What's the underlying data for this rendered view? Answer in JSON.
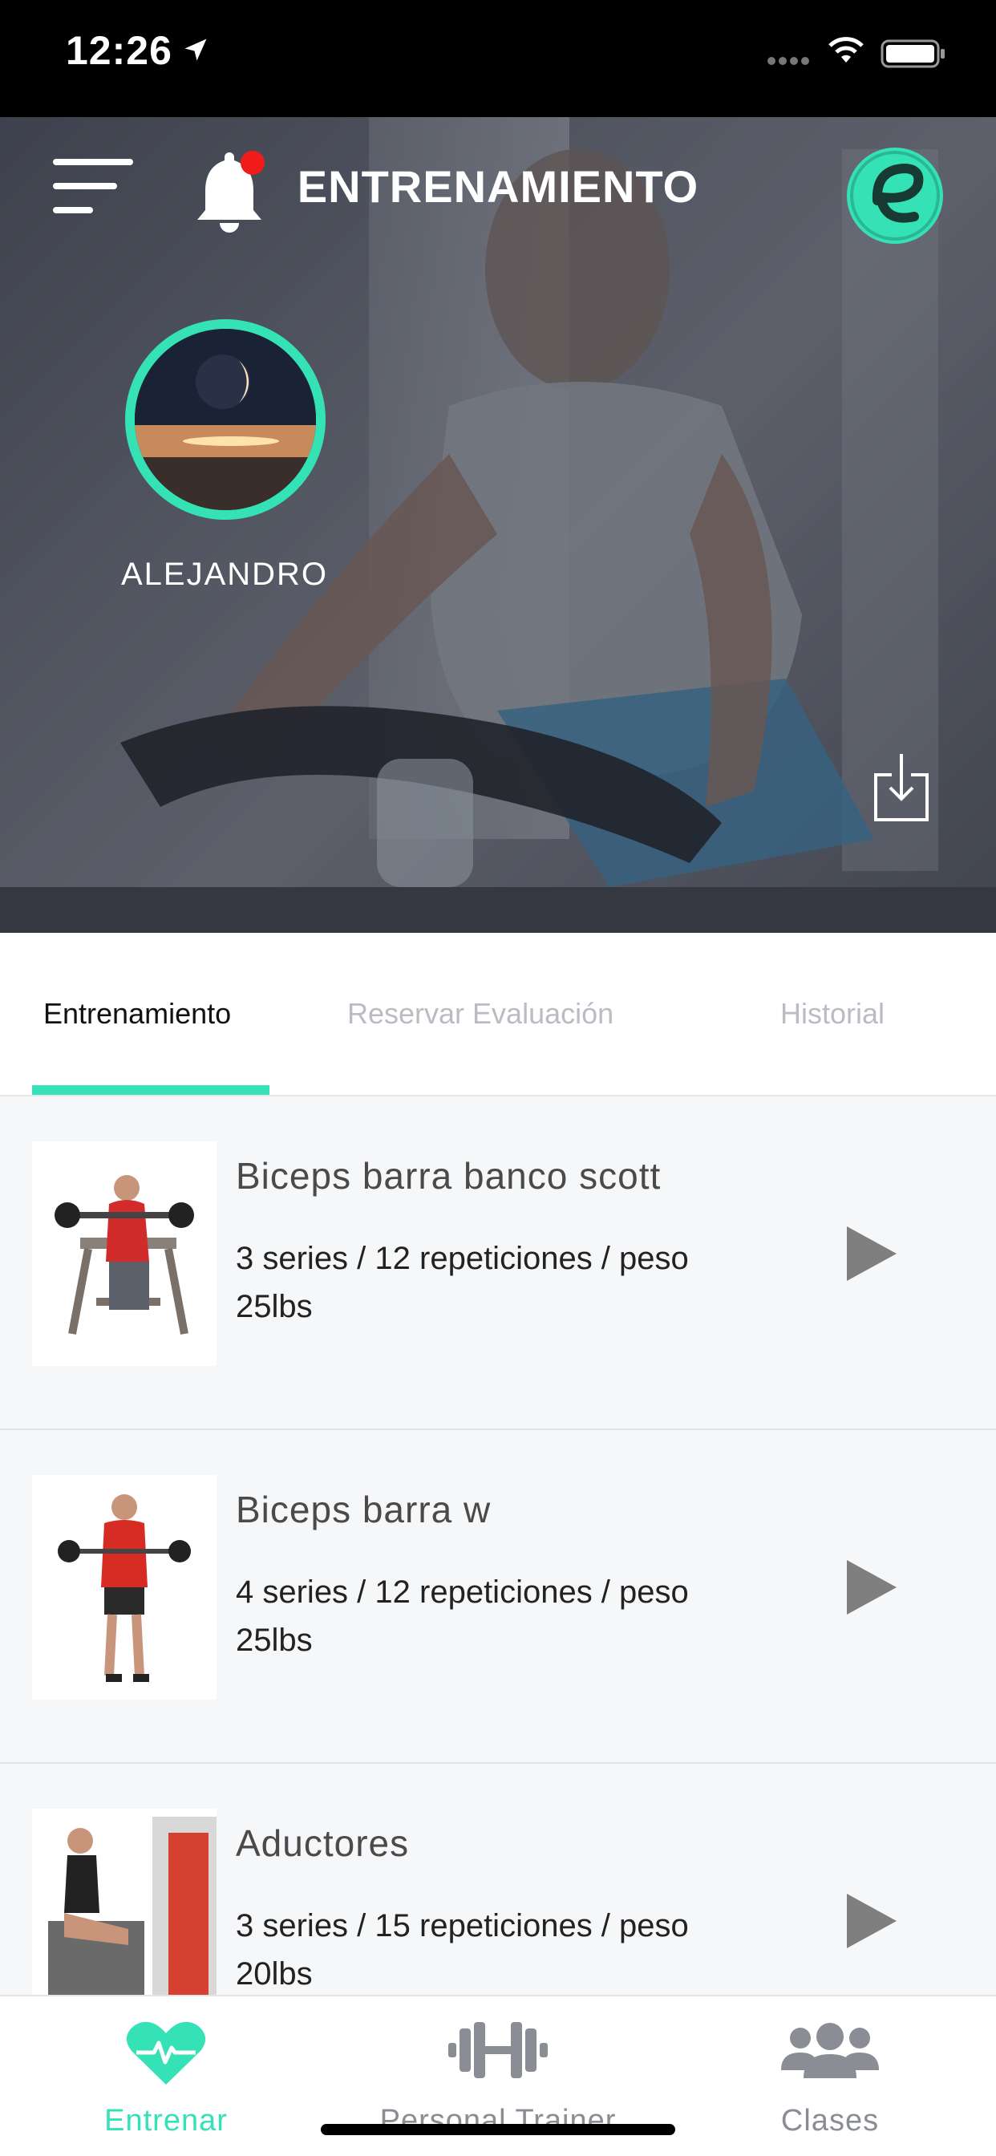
{
  "status_bar": {
    "time": "12:26"
  },
  "header": {
    "title": "ENTRENAMIENTO"
  },
  "profile": {
    "name": "ALEJANDRO"
  },
  "tabs": [
    {
      "label": "Entrenamiento",
      "active": true
    },
    {
      "label": "Reservar Evaluación",
      "active": false
    },
    {
      "label": "Historial",
      "active": false
    }
  ],
  "exercises": [
    {
      "title": "Biceps barra banco scott",
      "desc": "3 series / 12 repeticiones / peso 25lbs"
    },
    {
      "title": "Biceps barra w",
      "desc": "4 series / 12 repeticiones / peso 25lbs"
    },
    {
      "title": "Aductores",
      "desc": "3 series / 15 repeticiones / peso 20lbs"
    }
  ],
  "bottom_nav": [
    {
      "label": "Entrenar",
      "active": true,
      "icon": "heart-pulse-icon"
    },
    {
      "label": "Personal Trainer",
      "active": false,
      "icon": "dumbbell-icon"
    },
    {
      "label": "Clases",
      "active": false,
      "icon": "group-icon"
    }
  ],
  "colors": {
    "accent": "#34e2b6",
    "notification": "#f01b1b",
    "inactive": "#8a8d93"
  }
}
